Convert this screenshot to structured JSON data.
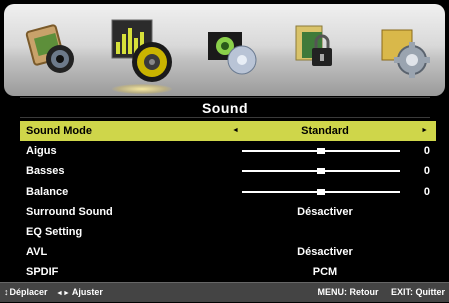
{
  "icons": [
    "picture-icon",
    "sound-icon",
    "channel-icon",
    "lock-icon",
    "setup-icon"
  ],
  "selected_icon": "sound-icon",
  "title": "Sound",
  "menu": {
    "items": [
      {
        "label": "Sound Mode",
        "value": "Standard",
        "selected": true
      },
      {
        "label": "Aigus",
        "level": 0.5,
        "number": "0"
      },
      {
        "label": "Basses",
        "level": 0.5,
        "number": "0"
      },
      {
        "label": "Balance",
        "level": 0.5,
        "number": "0"
      },
      {
        "label": "Surround Sound",
        "value": "Désactiver"
      },
      {
        "label": "EQ Setting"
      },
      {
        "label": "AVL",
        "value": "Désactiver"
      },
      {
        "label": "SPDIF",
        "value": "PCM"
      }
    ]
  },
  "arrows": {
    "left": "◄",
    "right": "►"
  },
  "footer": {
    "nav_icon": "↕",
    "move_label": "Déplacer",
    "adjust_icon": "◄►",
    "adjust_label": "Ajuster",
    "menu_label": "MENU: Retour",
    "exit_label": "EXIT: Quitter"
  },
  "colors": {
    "highlight": "#cfd64a",
    "background": "#000000",
    "footer": "#444444"
  }
}
